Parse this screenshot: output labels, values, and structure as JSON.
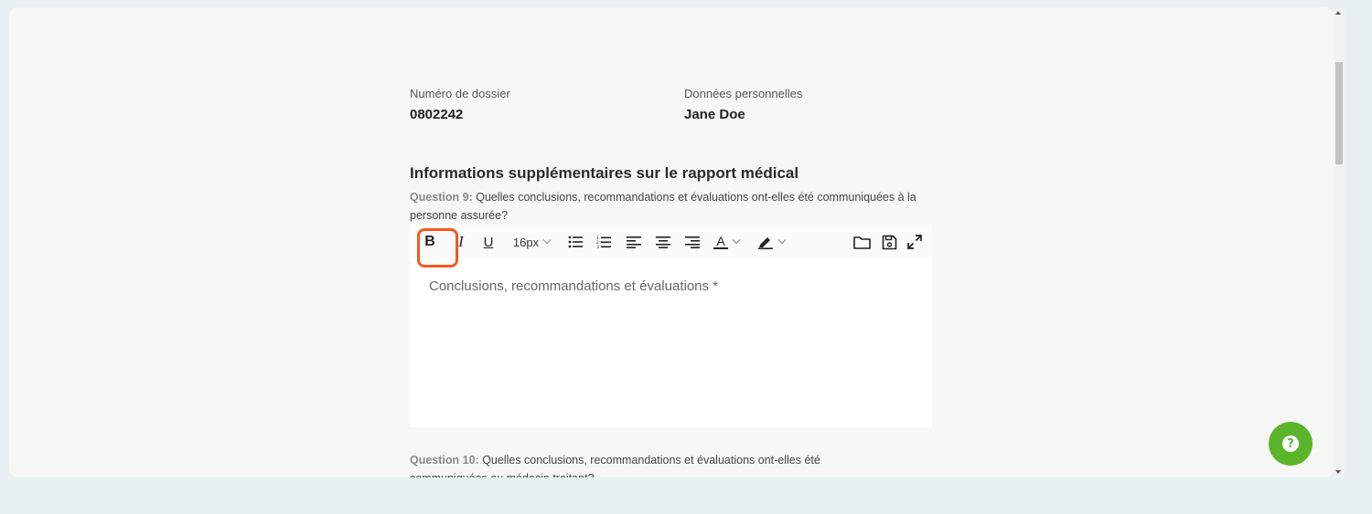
{
  "header": {
    "file_number_label": "Numéro de dossier",
    "file_number_value": "0802242",
    "personal_data_label": "Données personnelles",
    "personal_data_value": "Jane Doe"
  },
  "section": {
    "title": "Informations supplémentaires sur le rapport médical"
  },
  "question9": {
    "number": "Question 9:",
    "text": " Quelles conclusions, recommandations et évaluations ont-elles été communiquées à la personne assurée?"
  },
  "editor": {
    "toolbar": {
      "bold": "B",
      "italic": "I",
      "underline": "U",
      "font_size": "16px",
      "text_color_glyph": "A",
      "icons": {
        "bullet_list": "bullet-list-icon",
        "numbered_list": "numbered-list-icon",
        "align_left": "align-left-icon",
        "align_center": "align-center-icon",
        "align_right": "align-right-icon",
        "highlight": "highlighter-icon",
        "open": "folder-icon",
        "save": "save-icon",
        "fullscreen": "expand-icon"
      }
    },
    "placeholder": "Conclusions, recommandations et évaluations *"
  },
  "question10": {
    "number": "Question 10:",
    "text": " Quelles conclusions, recommandations et évaluations ont-elles été communiquées au médecin traitant?"
  },
  "help": {
    "glyph": "?"
  },
  "colors": {
    "highlight_border": "#f15a22",
    "help_button": "#5bb52a",
    "page_bg": "#e9f0f2",
    "panel_bg": "#f7f7f5"
  }
}
